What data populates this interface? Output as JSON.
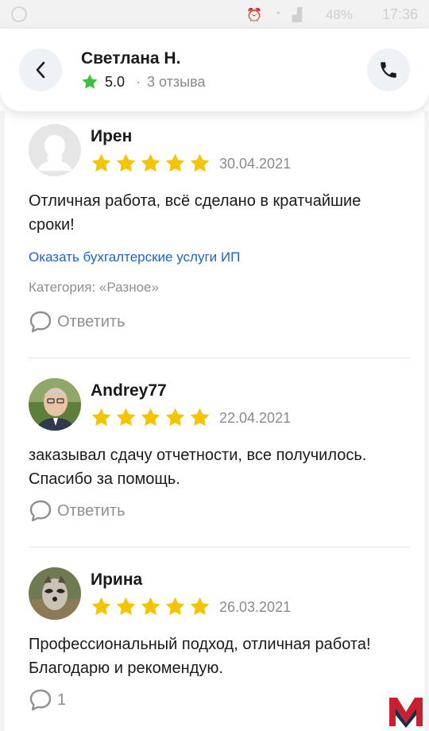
{
  "status_bar": {
    "battery": "48%",
    "time": "17:36"
  },
  "header": {
    "name": "Светлана Н.",
    "rating": "5.0",
    "separator": "·",
    "reviews_count": "3 отзыва"
  },
  "reviews": [
    {
      "author": "Ирен",
      "date": "30.04.2021",
      "stars": 5,
      "text": "Отличная работа, всё сделано в кратчайшие сроки!",
      "link": "Оказать бухгалтерские услуги ИП",
      "category": "Категория: «Разное»",
      "reply_label": "Ответить"
    },
    {
      "author": "Andrey77",
      "date": "22.04.2021",
      "stars": 5,
      "text": "заказывал сдачу отчетности, все получилось. Спасибо за помощь.",
      "reply_label": "Ответить"
    },
    {
      "author": "Ирина",
      "date": "26.03.2021",
      "stars": 5,
      "text": "Профессиональный подход, отличная работа! Благодарю и рекомендую.",
      "reply_count": "1"
    }
  ],
  "colors": {
    "star": "#f5c400",
    "rating_star": "#3fbf3f",
    "link": "#1f62c9",
    "muted": "#8f8f8f",
    "logo_red": "#c8202e",
    "logo_dark": "#1c2b4a"
  }
}
